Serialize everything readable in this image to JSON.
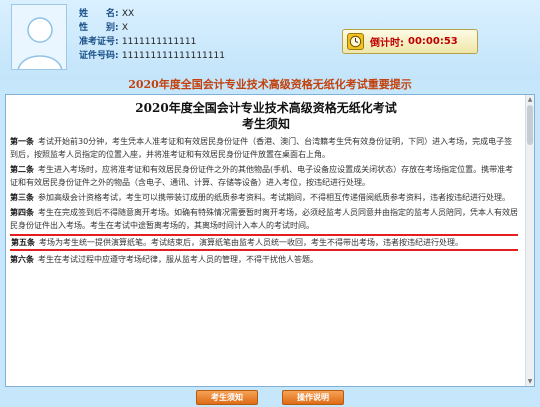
{
  "candidate": {
    "name_label": "姓　　名:",
    "name_value": "XX",
    "gender_label": "性　　别:",
    "gender_value": "X",
    "ticket_label": "准考证号:",
    "ticket_value": "1111111111111",
    "id_label": "证件号码:",
    "id_value": "111111111111111111"
  },
  "timer": {
    "label": "倒计时:",
    "value": "00:00:53",
    "icon": "clock-icon"
  },
  "banner": "2020年度全国会计专业技术高级资格无纸化考试重要提示",
  "document": {
    "title": "2020年度全国会计专业技术高级资格无纸化考试",
    "subtitle": "考生须知",
    "clauses": [
      {
        "no": "第一条",
        "text": "考试开始前30分钟，考生凭本人准考证和有效居民身份证件（香港、澳门、台湾籍考生凭有效身份证明，下同）进入考场，完成电子签到后，按照监考人员指定的位置入座，并将准考证和有效居民身份证件放置在桌面右上角。",
        "highlight": false
      },
      {
        "no": "第二条",
        "text": "考生进入考场时，应将准考证和有效居民身份证件之外的其他物品(手机、电子设备应设置成关闭状态）存放在考场指定位置。携带准考证和有效居民身份证件之外的物品（含电子、通讯、计算、存储等设备）进入考位，按违纪进行处理。",
        "highlight": false
      },
      {
        "no": "第三条",
        "text": "参加高级会计资格考试，考生可以携带装订成册的纸质参考资料。考试期间，不得相互传递借阅纸质参考资料，违者按违纪进行处理。",
        "highlight": false
      },
      {
        "no": "第四条",
        "text": "考生在完成签到后不得随意离开考场。如确有特殊情况需要暂时离开考场，必须经监考人员同意并由指定的监考人员陪同，凭本人有效居民身份证件出入考场。考生在考试中途暂离考场的，其离场时间计入本人的考试时间。",
        "highlight": false
      },
      {
        "no": "第五条",
        "text": "考场为考生统一提供演算纸笔。考试结束后，演算纸笔由监考人员统一收回，考生不得带出考场，违者按违纪进行处理。",
        "highlight": true
      },
      {
        "no": "第六条",
        "text": "考生在考试过程中应遵守考场纪律，服从监考人员的管理，不得干扰他人答题。",
        "highlight": false
      }
    ]
  },
  "buttons": {
    "notice_label": "考生须知",
    "operation_label": "操作说明"
  },
  "colors": {
    "banner": "#c2410c",
    "highlight_border": "#e41e1e",
    "button": "#e5781f",
    "timer_text": "#c00000"
  }
}
